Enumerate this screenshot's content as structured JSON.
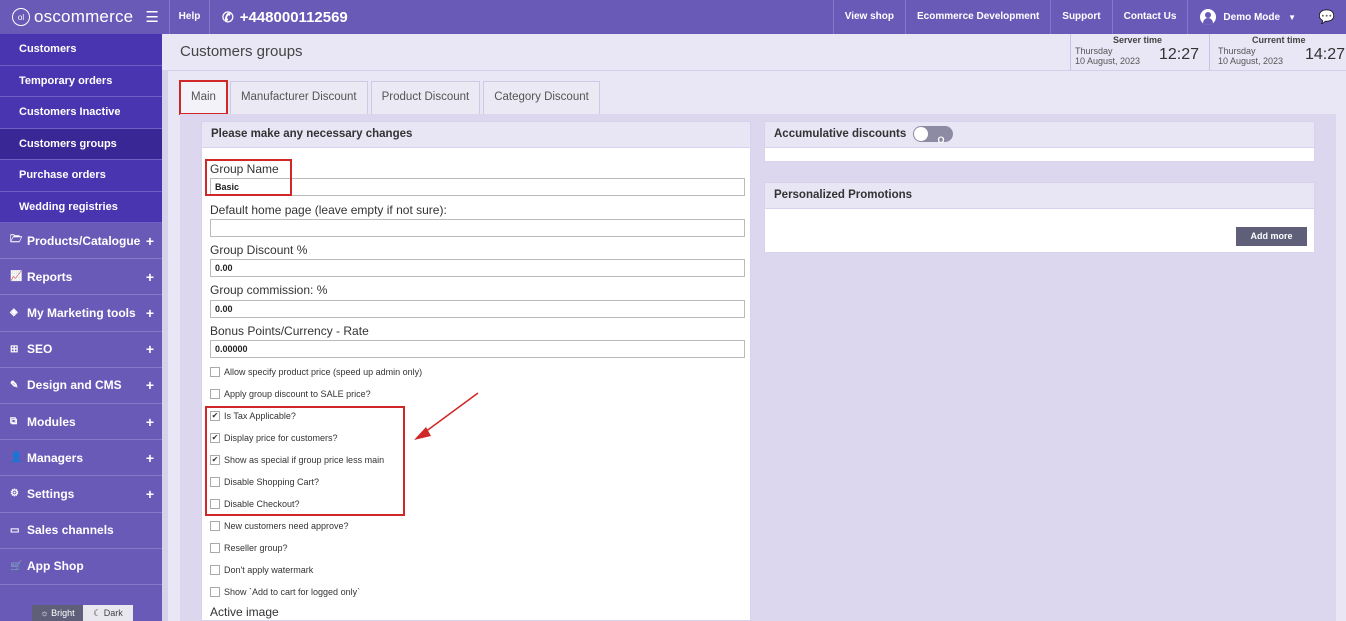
{
  "topbar": {
    "logo_text": "oscommerce",
    "logo_mark": "ol",
    "help": "Help",
    "phone": "+448000112569",
    "links": [
      "View shop",
      "Ecommerce Development",
      "Support",
      "Contact Us"
    ],
    "user": "Demo Mode"
  },
  "sidebar": {
    "sub_items": [
      "Customers",
      "Temporary orders",
      "Customers Inactive",
      "Customers groups",
      "Purchase orders",
      "Wedding registries"
    ],
    "main_items": [
      "Products/Catalogue",
      "Reports",
      "My Marketing tools",
      "SEO",
      "Design and CMS",
      "Modules",
      "Managers",
      "Settings",
      "Sales channels",
      "App Shop"
    ],
    "theme_bright": "Bright",
    "theme_dark": "Dark"
  },
  "header": {
    "title": "Customers groups",
    "server_label": "Server time",
    "server_day": "Thursday",
    "server_date": "10 August, 2023",
    "server_time": "12:27",
    "current_label": "Current time",
    "current_day": "Thursday",
    "current_date": "10 August, 2023",
    "current_time": "14:27"
  },
  "tabs": [
    "Main",
    "Manufacturer Discount",
    "Product Discount",
    "Category Discount"
  ],
  "form": {
    "heading": "Please make any necessary changes",
    "group_name_label": "Group Name",
    "group_name_value": "Basic",
    "home_page_label": "Default home page (leave empty if not sure):",
    "home_page_value": "",
    "discount_label": "Group Discount %",
    "discount_value": "0.00",
    "commission_label": "Group commission: %",
    "commission_value": "0.00",
    "bonus_label": "Bonus Points/Currency - Rate",
    "bonus_value": "0.00000",
    "checkboxes": [
      {
        "label": "Allow specify product price (speed up admin only)",
        "checked": false
      },
      {
        "label": "Apply group discount to SALE price?",
        "checked": false
      },
      {
        "label": "Is Tax Applicable?",
        "checked": true
      },
      {
        "label": "Display price for customers?",
        "checked": true
      },
      {
        "label": "Show as special if group price less main",
        "checked": true
      },
      {
        "label": "Disable Shopping Cart?",
        "checked": false
      },
      {
        "label": "Disable Checkout?",
        "checked": false
      },
      {
        "label": "New customers need approve?",
        "checked": false
      },
      {
        "label": "Reseller group?",
        "checked": false
      },
      {
        "label": "Don't apply watermark",
        "checked": false
      },
      {
        "label": "Show `Add to cart for logged only`",
        "checked": false
      }
    ],
    "active_image_label": "Active image"
  },
  "accumulative": {
    "heading": "Accumulative discounts",
    "toggle_text": "O"
  },
  "promotions": {
    "heading": "Personalized Promotions",
    "add_more": "Add more"
  },
  "colors": {
    "topbar": "#6a5ab8",
    "sidebar_sub": "#4a35b0",
    "highlight": "#d02727"
  }
}
